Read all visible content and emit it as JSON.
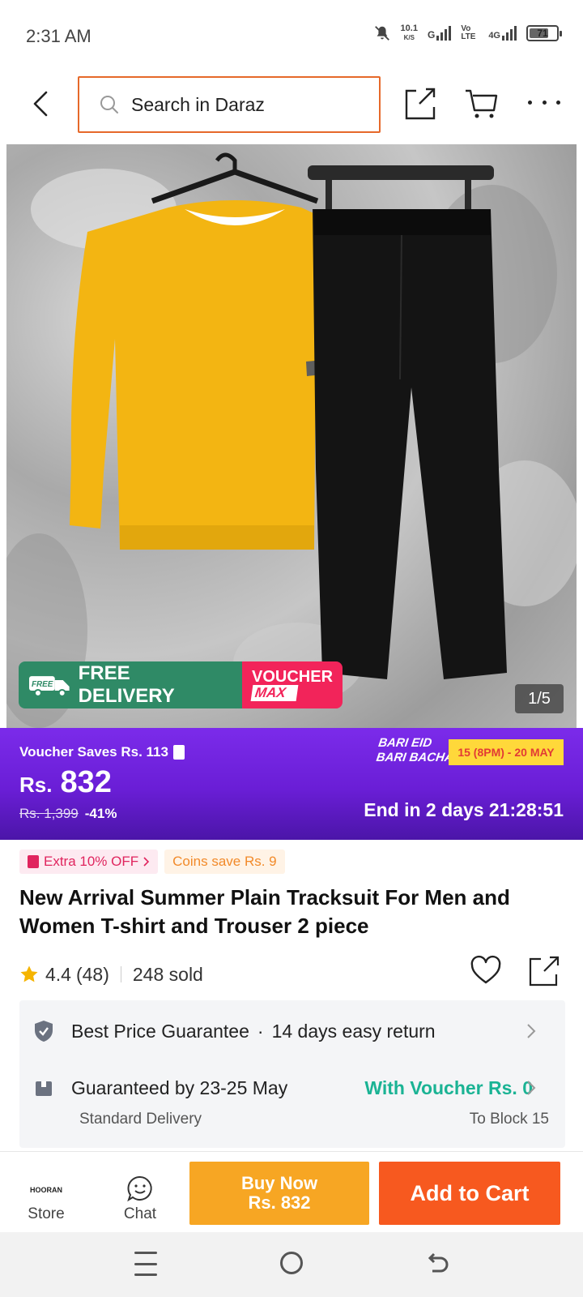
{
  "status_bar": {
    "time": "2:31 AM",
    "net_speed": "10.1",
    "net_unit": "K/S",
    "sim1": "G",
    "sim2_label": "Vo LTE",
    "sim2_gen": "4G",
    "battery": "71"
  },
  "header": {
    "search_placeholder": "Search in Daraz"
  },
  "gallery": {
    "free_delivery_badge": "FREE",
    "free_delivery_text": "FREE DELIVERY",
    "voucher_line1": "VOUCHER",
    "voucher_line2": "MAX",
    "pager": "1/5"
  },
  "price_banner": {
    "voucher_saves": "Voucher Saves Rs. 113",
    "currency": "Rs.",
    "price": "832",
    "original_price": "Rs. 1,399",
    "discount": "-41%",
    "campaign_line1": "BARI EID",
    "campaign_line2": "BARI BACHAT",
    "campaign_dates": "15 (8PM) - 20 MAY",
    "countdown": "End in 2 days 21:28:51"
  },
  "promos": {
    "extra_off": "Extra 10% OFF",
    "coins": "Coins save Rs. 9"
  },
  "product": {
    "title": "New Arrival Summer Plain Tracksuit For Men and Women T-shirt and Trouser 2 piece",
    "rating": "4.4",
    "reviews": "(48)",
    "sold": "248 sold"
  },
  "services": {
    "best_price": "Best Price Guarantee",
    "dot": "·",
    "easy_return": "14 days easy return",
    "guaranteed": "Guaranteed by 23-25 May",
    "voucher_delivery": "With Voucher Rs. 0",
    "standard": "Standard Delivery",
    "destination": "To Block 15"
  },
  "actions": {
    "store_logo": "HOORAN",
    "store": "Store",
    "chat": "Chat",
    "buy_now_line1": "Buy Now",
    "buy_now_line2": "Rs. 832",
    "add_to_cart": "Add to Cart"
  },
  "colors": {
    "accent": "#f7591f",
    "buy_now": "#f7a623",
    "banner_purple": "#6a1ed6",
    "voucher_green": "#1ab394"
  }
}
